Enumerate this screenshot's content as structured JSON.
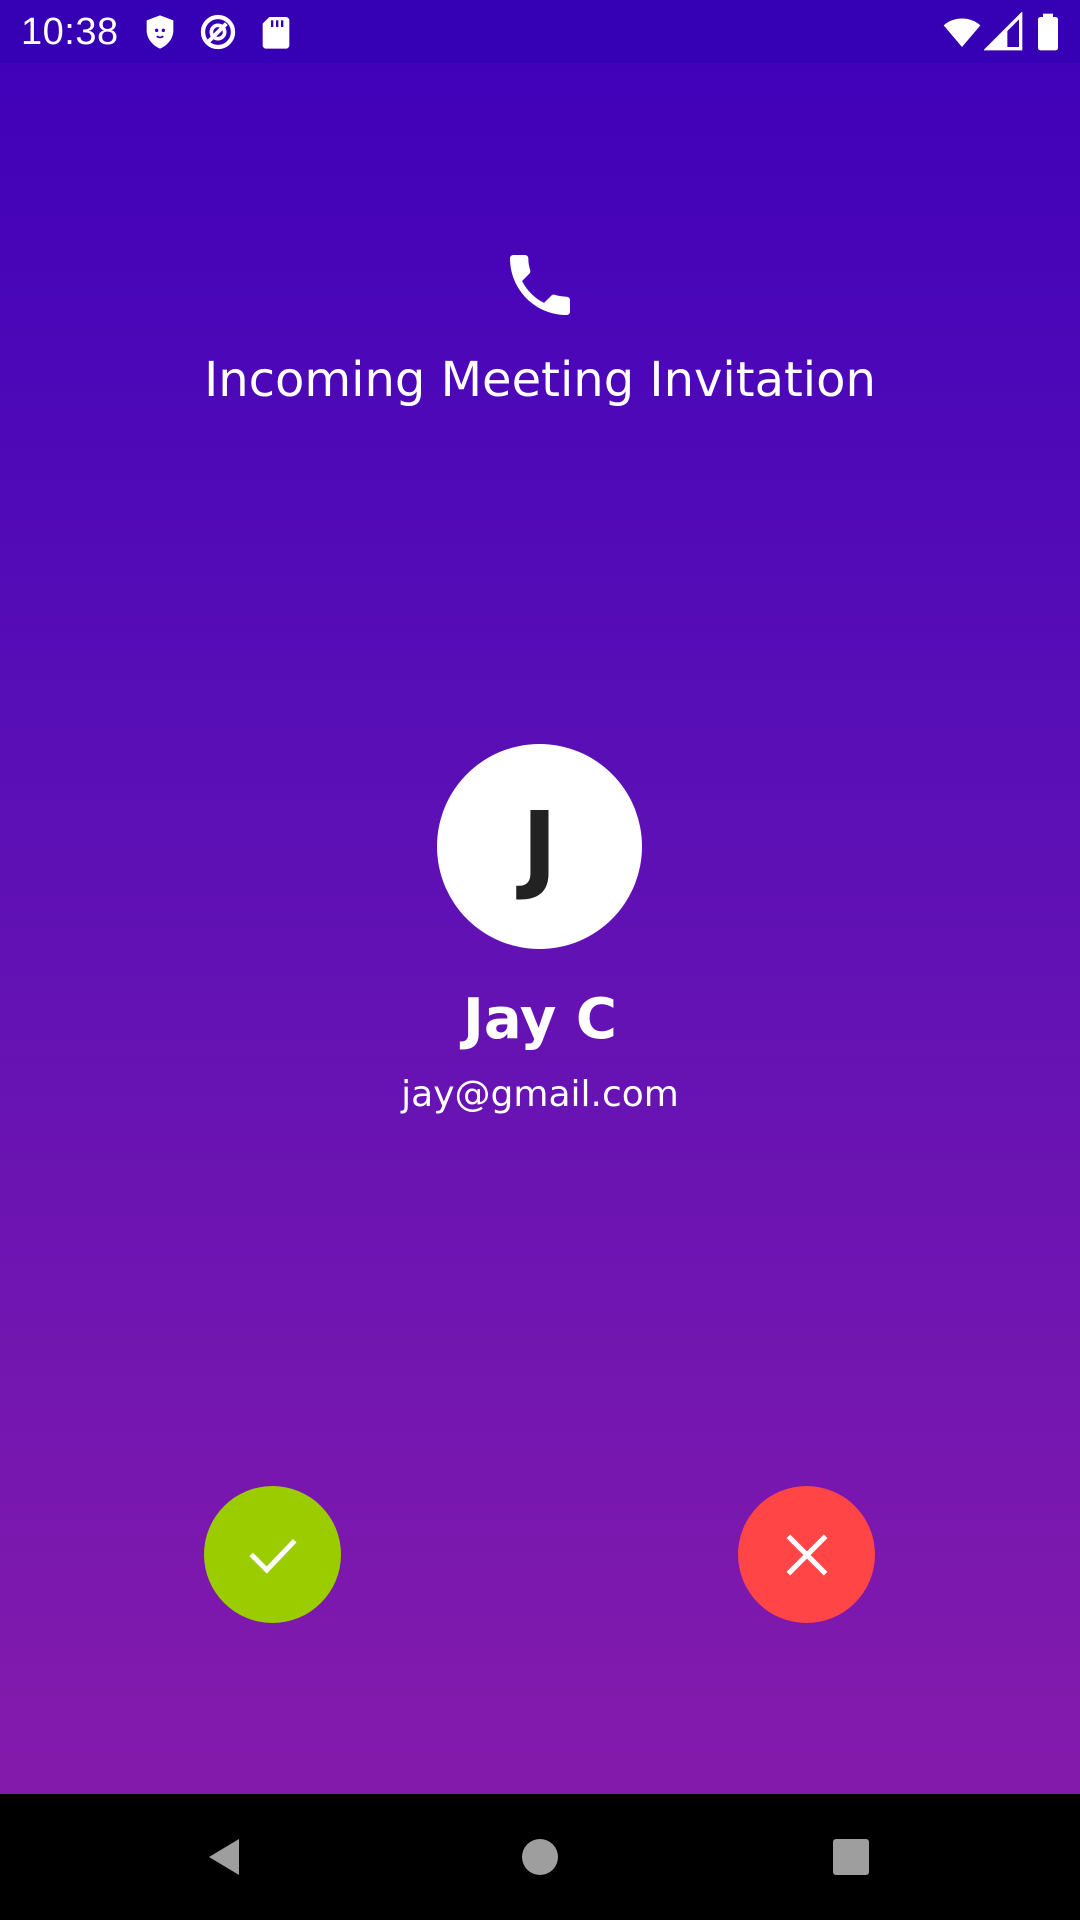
{
  "status_bar": {
    "time": "10:38",
    "left_icons": [
      "shield-icon",
      "sync-circle-icon",
      "sd-card-icon"
    ],
    "right_icons": [
      "wifi-icon",
      "cell-signal-icon",
      "battery-icon"
    ]
  },
  "header": {
    "icon": "phone-icon",
    "title": "Incoming Meeting Invitation"
  },
  "caller": {
    "initial": "J",
    "name": "Jay C",
    "email": "jay@gmail.com"
  },
  "actions": {
    "accept_icon": "check-icon",
    "decline_icon": "close-icon"
  },
  "colors": {
    "background_top": "#3f00b9",
    "background_bottom": "#8a1cab",
    "status_bar": "#3600b4",
    "accept": "#9bcc00",
    "decline": "#ff4545",
    "avatar_bg": "#ffffff"
  },
  "nav_bar": {
    "buttons": [
      "back-icon",
      "home-icon",
      "recents-icon"
    ]
  }
}
